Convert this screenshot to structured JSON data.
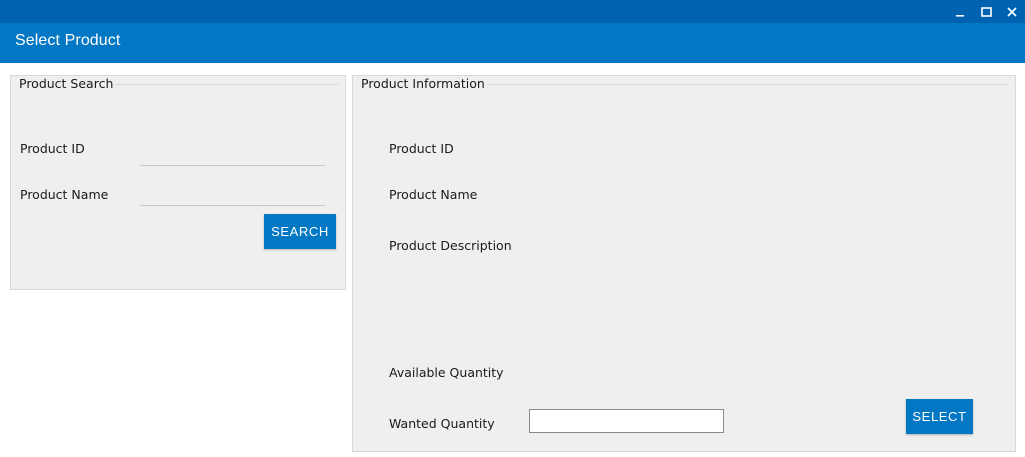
{
  "window": {
    "controls": {
      "minimize_icon": "minimize-icon",
      "maximize_icon": "maximize-icon",
      "close_icon": "close-icon"
    }
  },
  "header": {
    "title": "Select Product"
  },
  "search_panel": {
    "legend": "Product Search",
    "product_id_label": "Product ID",
    "product_id_value": "",
    "product_name_label": "Product Name",
    "product_name_value": "",
    "search_button_label": "SEARCH"
  },
  "info_panel": {
    "legend": "Product Information",
    "product_id_label": "Product ID",
    "product_name_label": "Product Name",
    "product_description_label": "Product Description",
    "available_quantity_label": "Available Quantity",
    "wanted_quantity_label": "Wanted Quantity",
    "wanted_quantity_value": "",
    "select_button_label": "SELECT"
  },
  "colors": {
    "titlebar": "#0063b1",
    "header": "#0277c3",
    "panel_bg": "#efefef",
    "button": "#0277c3"
  }
}
